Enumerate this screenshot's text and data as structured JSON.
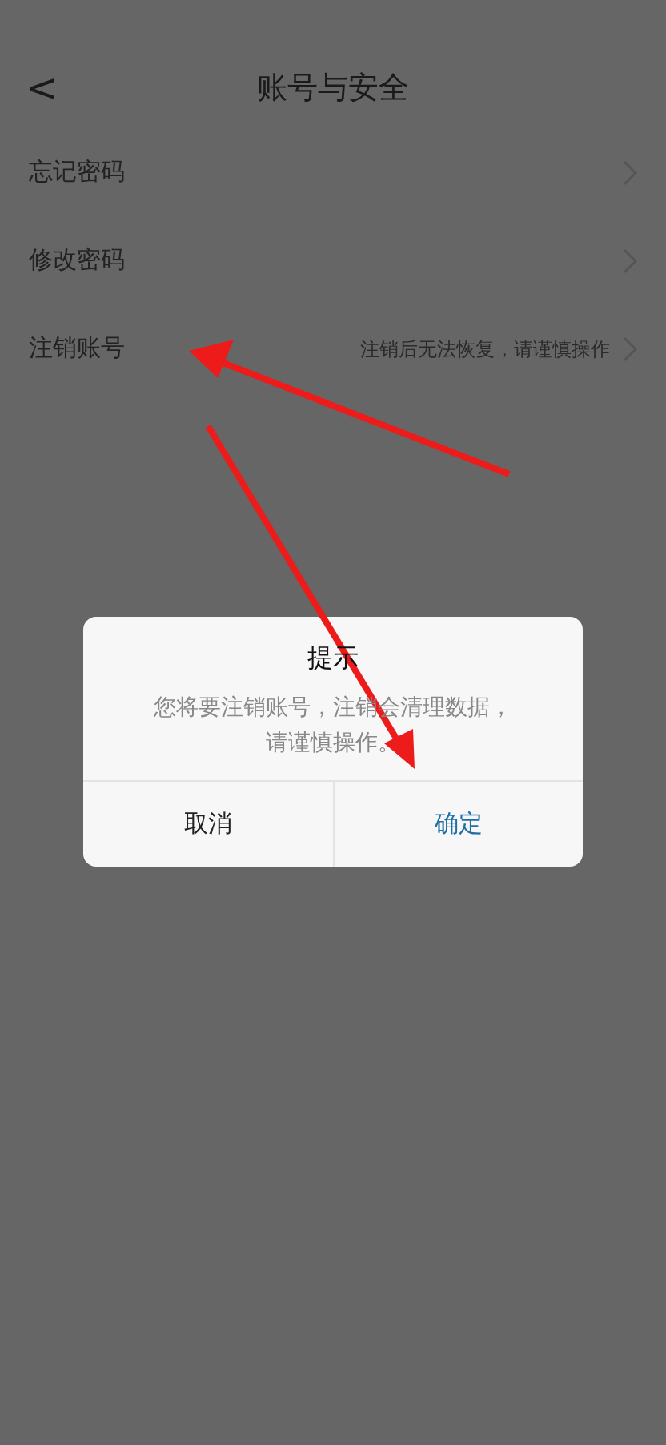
{
  "header": {
    "back": "<",
    "title": "账号与安全"
  },
  "rows": [
    {
      "label": "忘记密码"
    },
    {
      "label": "修改密码"
    },
    {
      "label": "注销账号",
      "hint": "注销后无法恢复，请谨慎操作"
    }
  ],
  "dialog": {
    "title": "提示",
    "message": "您将要注销账号，注销会清理数据，请谨慎操作。",
    "buttons": [
      {
        "label": "取消",
        "kind": "cancel"
      },
      {
        "label": "确定",
        "kind": "confirm"
      }
    ]
  }
}
